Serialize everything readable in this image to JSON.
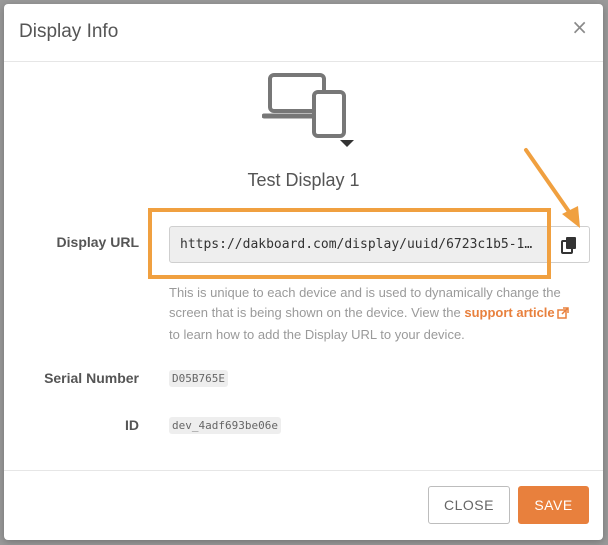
{
  "modal": {
    "title": "Display Info",
    "close_symbol": "×",
    "device_icon": "laptop-phone-icon",
    "device_name": "Test Display 1"
  },
  "display_url": {
    "label": "Display URL",
    "value": "https://dakboard.com/display/uuid/6723c1b5-1…",
    "copy_icon": "copy-icon",
    "help_before": "This is unique to each device and is used to dynamically change the screen that is being shown on the device. View the ",
    "help_link": "support article",
    "help_after": " to learn how to add the Display URL to your device."
  },
  "serial": {
    "label": "Serial Number",
    "value": "D05B765E"
  },
  "id": {
    "label": "ID",
    "value": "dev_4adf693be06e"
  },
  "footer": {
    "close_label": "CLOSE",
    "save_label": "SAVE"
  },
  "colors": {
    "accent": "#e8803d",
    "annotation": "#f0a040"
  }
}
